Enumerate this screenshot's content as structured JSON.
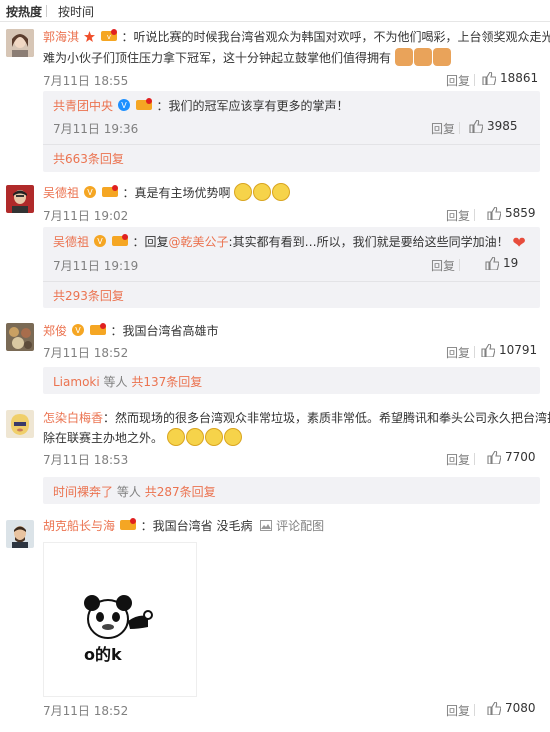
{
  "sort": {
    "hot": "按热度",
    "time": "按时间"
  },
  "comments": [
    {
      "user": "郭海淇",
      "text1": "：听说比赛的时候我台湾省观众为韩国对欢呼，不为他们喝彩，上台领奖观众走光，",
      "text2": "难为小伙子们顶住压力拿下冠军，这十分钟起立鼓掌他们值得拥有",
      "date": "7月11日 18:55",
      "reply": "回复",
      "likes": "18861",
      "sub": {
        "user": "共青团中央",
        "text": "：我们的冠军应该享有更多的掌声！",
        "date": "7月11日 19:36",
        "reply": "回复",
        "likes": "3985",
        "more": "共663条回复"
      }
    },
    {
      "user": "吴德祖",
      "text1": "：真是有主场优势啊",
      "date": "7月11日 19:02",
      "reply": "回复",
      "likes": "5859",
      "sub": {
        "user": "吴德祖",
        "text_pre": "：回复",
        "mention": "@乾美公子",
        "text": ":其实都有看到…所以，我们就是要给这些同学加油！",
        "date": "7月11日 19:19",
        "reply": "回复",
        "likes": "19",
        "more": "共293条回复"
      }
    },
    {
      "user": "郑俊",
      "text1": "：我国台湾省高雄市",
      "date": "7月11日 18:52",
      "reply": "回复",
      "likes": "10791",
      "sub": {
        "who": "Liamoki",
        "etc": "等人",
        "more": "共137条回复"
      }
    },
    {
      "user": "怎染白梅香",
      "text1": "：然而现场的很多台湾观众非常垃圾，素质非常低。希望腾讯和拳头公司永久把台湾排",
      "text2": "除在联赛主办地之外。",
      "date": "7月11日 18:53",
      "reply": "回复",
      "likes": "7700",
      "sub": {
        "who": "时间裸奔了",
        "etc": "等人",
        "more": "共287条回复"
      }
    },
    {
      "user": "胡克船长与海",
      "text1": "：我国台湾省 没毛病",
      "pic_label": "评论配图",
      "meme_text": "o的k",
      "date": "7月11日 18:52",
      "reply": "回复",
      "likes": "7080"
    }
  ]
}
